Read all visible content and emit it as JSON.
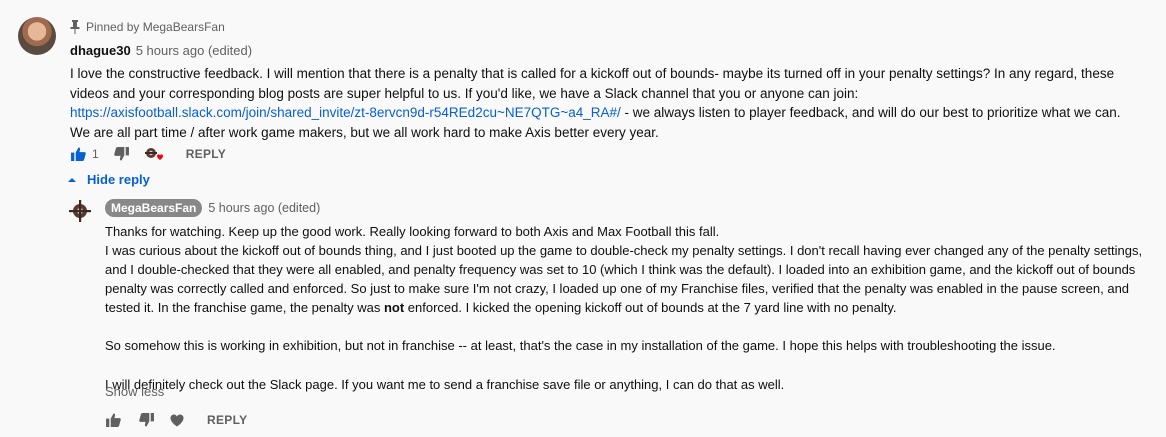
{
  "comment": {
    "pinned_label": "Pinned by MegaBearsFan",
    "author": "dhague30",
    "time": "5 hours ago (edited)",
    "text_1": "I love the constructive feedback.  I will mention that there is a penalty that is called for a kickoff out of bounds- maybe its turned off in your penalty settings?  In any regard, these videos and your corresponding blog posts are super helpful to us.  If you'd like, we have a Slack channel that you or anyone can join: ",
    "link": "https://axisfootball.slack.com/join/shared_invite/zt-8ervcn9d-r54REd2cu~NE7QTG~a4_RA#/",
    "text_2": " - we always listen to player feedback, and will do our best to prioritize what we can.  We are all part time / after work game makers, but we all work hard to make Axis better every year.",
    "like_count": "1",
    "reply_label": "REPLY",
    "icons": [
      "pin-icon",
      "thumbs-up-icon",
      "thumbs-down-icon",
      "creator-heart-icon"
    ]
  },
  "hide_reply_label": "Hide reply",
  "reply": {
    "author": "MegaBearsFan",
    "time": "5 hours ago (edited)",
    "line_1": "Thanks for watching. Keep up the good work. Really looking forward to both Axis and Max Football this fall.",
    "line_2a": "I was curious about the kickoff out of bounds thing, and I just booted up the game to double-check my penalty settings. I don't recall having ever changed any of the penalty settings, and I double-checked that they were all enabled, and penalty frequency was set to 10 (which I think was the default). I loaded into an exhibition game, and the kickoff out of bounds penalty was correctly called and enforced. So just to make sure I'm not crazy, I loaded up one of my Franchise files, verified that the penalty was enabled in the pause screen, and tested it. In the franchise game, the penalty was ",
    "line_2_bold": "not",
    "line_2b": " enforced. I kicked the opening kickoff out of bounds at the 7 yard line with no penalty.",
    "line_3": "So somehow this is working in exhibition, but not in franchise -- at least, that's the case in my installation of the game. I hope this helps with troubleshooting the issue.",
    "line_4": "I will definitely check out the Slack page. If you want me to send a franchise save file or anything, I can do that as well.",
    "show_less_label": "Show less",
    "reply_label": "REPLY",
    "icons": [
      "thumbs-up-icon",
      "thumbs-down-icon",
      "heart-icon"
    ]
  },
  "colors": {
    "link": "#065fd4",
    "secondary_text": "#606060",
    "badge_bg": "#888888",
    "heart": "#ff0000"
  }
}
